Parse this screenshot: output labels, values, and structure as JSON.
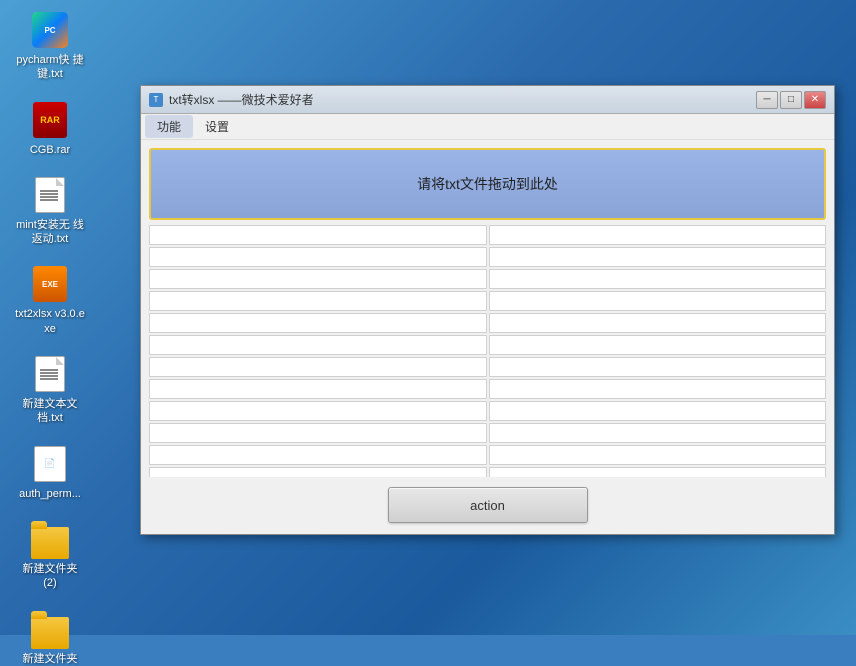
{
  "desktop": {
    "icons": [
      {
        "id": "pycharm-icon",
        "label": "pycharm快\n捷键.txt",
        "type": "pycharm"
      },
      {
        "id": "cgb-rar-icon",
        "label": "CGB.rar",
        "type": "rar"
      },
      {
        "id": "mint-icon",
        "label": "mint安装无\n线返动.txt",
        "type": "txt"
      },
      {
        "id": "txt2xlsx-icon",
        "label": "txt2xlsx\nv3.0.exe",
        "type": "exe"
      },
      {
        "id": "new-txt-icon",
        "label": "新建文本文\n档.txt",
        "type": "txt"
      },
      {
        "id": "auth-perm-icon",
        "label": "auth_perm...",
        "type": "generic"
      },
      {
        "id": "new-folder2-icon",
        "label": "新建文件夹\n(2)",
        "type": "folder"
      },
      {
        "id": "new-folder-icon",
        "label": "新建文件夹",
        "type": "folder"
      }
    ]
  },
  "window": {
    "title": "txt转xlsx ——微技术爱好者",
    "title_icon": "T",
    "menu_items": [
      "功能",
      "设置"
    ],
    "active_menu": "功能",
    "drop_zone_text": "请将txt文件拖动到此处",
    "table_rows": 12,
    "action_button_label": "action"
  }
}
